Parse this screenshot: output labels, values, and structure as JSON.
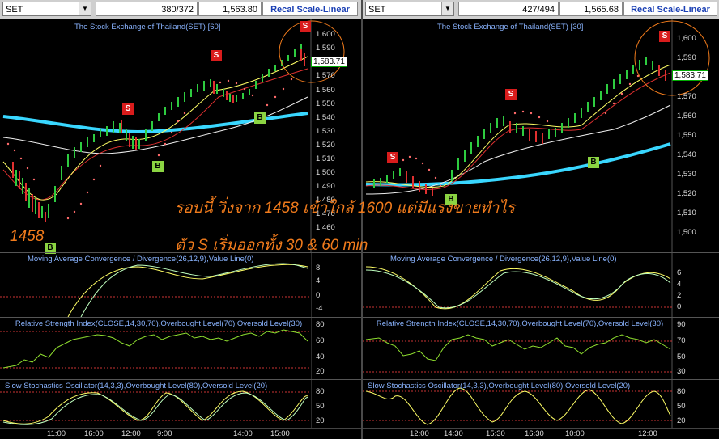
{
  "left": {
    "symbol": "SET",
    "count": "380/372",
    "last_price": "1,563.80",
    "recal_label": "Recal Scale-Linear",
    "chart_title": "The Stock Exchange of Thailand(SET) [60]",
    "price_ticks": [
      "1,600",
      "1,590",
      "1,580",
      "1,570",
      "1,560",
      "1,550",
      "1,540",
      "1,530",
      "1,520",
      "1,510",
      "1,500",
      "1,490",
      "1,480",
      "1,470",
      "1,460"
    ],
    "current_price_label": "1,583.71",
    "low_label": "1458",
    "macd_title": "Moving Average Convergence / Divergence(26,12,9),Value Line(0)",
    "macd_ticks": [
      "8",
      "4",
      "0",
      "-4"
    ],
    "rsi_title": "Relative Strength Index(CLOSE,14,30,70),Overbought Level(70),Oversold Level(30)",
    "rsi_ticks": [
      "80",
      "60",
      "40",
      "20"
    ],
    "sto_title": "Slow Stochastics Oscillator(14,3,3),Overbought Level(80),Oversold Level(20)",
    "sto_ticks": [
      "80",
      "50",
      "20"
    ],
    "time_labels": [
      "11:00",
      "16:00",
      "12:00",
      "9:00",
      "14:00",
      "15:00"
    ],
    "markers": [
      "S",
      "B",
      "S",
      "B",
      "S",
      "B",
      "S"
    ]
  },
  "right": {
    "symbol": "SET",
    "count": "427/494",
    "last_price": "1,565.68",
    "recal_label": "Recal Scale-Linear",
    "chart_title": "The Stock Exchange of Thailand(SET) [30]",
    "price_ticks": [
      "1,600",
      "1,590",
      "1,580",
      "1,570",
      "1,560",
      "1,550",
      "1,540",
      "1,530",
      "1,520",
      "1,510",
      "1,500"
    ],
    "current_price_label": "1,583.71",
    "macd_title": "Moving Average Convergence / Divergence(26,12,9),Value Line(0)",
    "macd_ticks": [
      "6",
      "4",
      "2",
      "0"
    ],
    "rsi_title": "Relative Strength Index(CLOSE,14,30,70),Overbought Level(70),Oversold Level(30)",
    "rsi_ticks": [
      "90",
      "70",
      "50",
      "30"
    ],
    "sto_title": "Slow Stochastics Oscillator(14,3,3),Overbought Level(80),Oversold Level(20)",
    "sto_ticks": [
      "80",
      "50",
      "20"
    ],
    "time_labels": [
      "12:00",
      "14:30",
      "15:30",
      "16:30",
      "10:00",
      "12:00"
    ],
    "markers": [
      "S",
      "B",
      "S",
      "S",
      "B",
      "S"
    ]
  },
  "annotation": {
    "line1": "รอบนี้ วิ่งจาก 1458 เข้าใกล้ 1600 แต่มีแรงขายทำไร",
    "line2": "ตัว S เริ่มออกทั้ง 30 & 60 min"
  },
  "colors": {
    "sell": "#d91c1c",
    "buy": "#8bd442",
    "ma_cyan": "#39d7ff",
    "annotation": "#f07b1c"
  }
}
